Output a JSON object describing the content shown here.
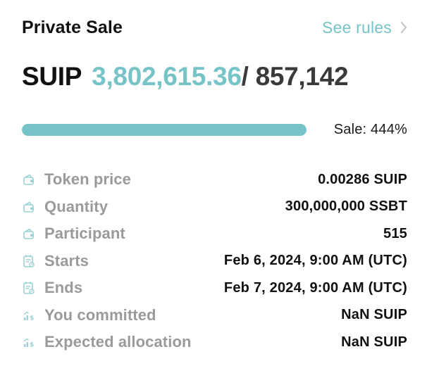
{
  "header": {
    "title": "Private Sale",
    "rules_link": "See rules"
  },
  "sale": {
    "token_symbol": "SUIP",
    "committed": "3,802,615.36",
    "cap": "/ 857,142",
    "progress_percent": 100,
    "sale_label": "Sale: 444%"
  },
  "details": [
    {
      "icon": "wallet-icon",
      "label": "Token price",
      "value": "0.00286 SUIP"
    },
    {
      "icon": "wallet-icon",
      "label": "Quantity",
      "value": "300,000,000 SSBT"
    },
    {
      "icon": "wallet-icon",
      "label": "Participant",
      "value": "515"
    },
    {
      "icon": "calendar-icon",
      "label": "Starts",
      "value": "Feb 6, 2024, 9:00 AM (UTC)"
    },
    {
      "icon": "calendar-icon",
      "label": "Ends",
      "value": "Feb 7, 2024, 9:00 AM (UTC)"
    },
    {
      "icon": "chart-dollar-icon",
      "label": "You committed",
      "value": "NaN SUIP"
    },
    {
      "icon": "chart-dollar-icon",
      "label": "Expected allocation",
      "value": "NaN SUIP"
    }
  ],
  "colors": {
    "accent": "#76c3c8",
    "text": "#111111",
    "muted": "#9a9a9a",
    "track": "#e6f3f4"
  }
}
